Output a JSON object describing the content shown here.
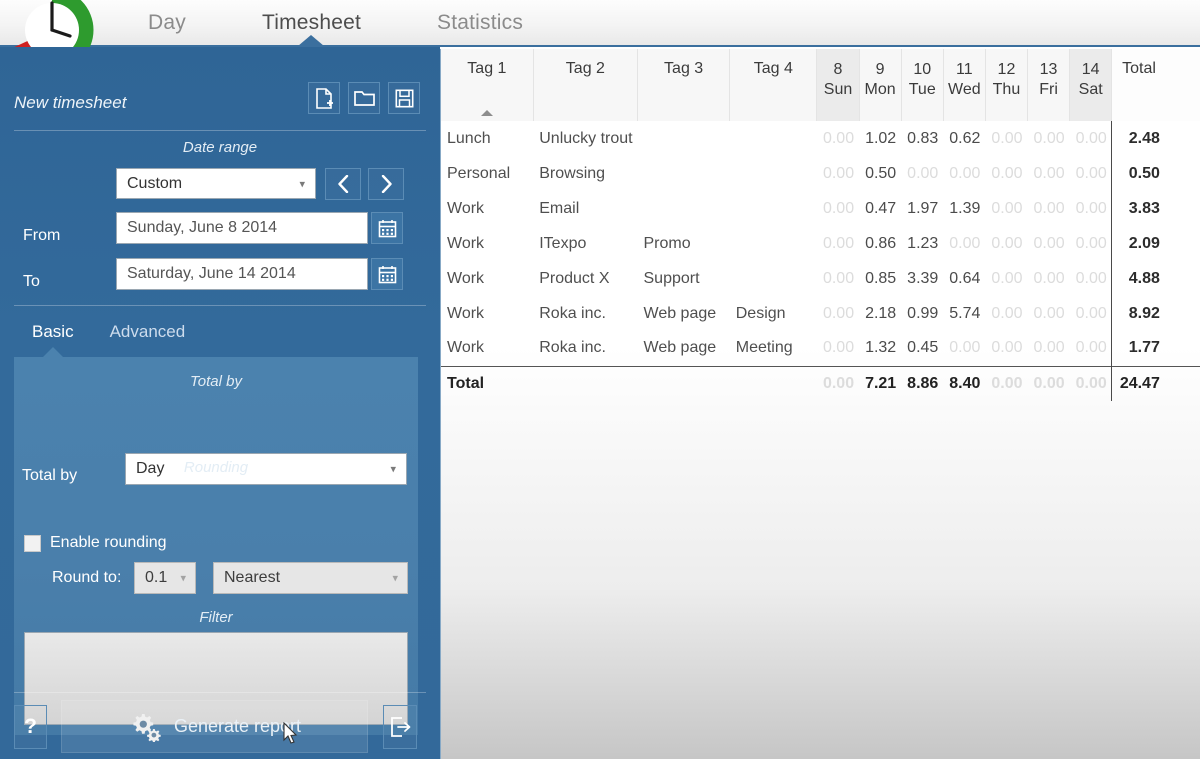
{
  "nav": {
    "tabs": [
      {
        "label": "Day",
        "active": false
      },
      {
        "label": "Timesheet",
        "active": true
      },
      {
        "label": "Statistics",
        "active": false
      }
    ]
  },
  "logo": {
    "name": "clock-logo",
    "green": "#2e9b2e",
    "red": "#cf2020"
  },
  "sidebar": {
    "accent": "#33699a",
    "panel_accent": "#4b82ae",
    "timesheet_title": "New timesheet",
    "icons": {
      "new": "new-document-icon",
      "open": "open-folder-icon",
      "save": "save-floppy-icon"
    },
    "date_range": {
      "section_label": "Date range",
      "preset_value": "Custom",
      "prev_label": "‹",
      "next_label": "›",
      "from_label": "From",
      "from_value": "Sunday, June 8 2014",
      "to_label": "To",
      "to_value": "Saturday, June 14 2014"
    },
    "subtabs": [
      {
        "label": "Basic",
        "active": true
      },
      {
        "label": "Advanced",
        "active": false
      }
    ],
    "total_by": {
      "section_label": "Total by",
      "field_label": "Total by",
      "value": "Day"
    },
    "rounding": {
      "section_label": "Rounding",
      "enable_label": "Enable rounding",
      "enabled": false,
      "round_to_label": "Round to:",
      "amount_value": "0.1",
      "mode_value": "Nearest"
    },
    "filter": {
      "section_label": "Filter",
      "value": "",
      "placeholder": ""
    },
    "footer": {
      "help_label": "?",
      "generate_label": "Generate report",
      "exit_label": "exit-icon"
    }
  },
  "chart_data": {
    "type": "table",
    "title": "Timesheet",
    "columns": [
      "Tag 1",
      "Tag 2",
      "Tag 3",
      "Tag 4",
      "8 Sun",
      "9 Mon",
      "10 Tue",
      "11 Wed",
      "12 Thu",
      "13 Fri",
      "14 Sat",
      "Total"
    ],
    "day_columns": [
      {
        "num": "8",
        "day": "Sun",
        "weekend": true
      },
      {
        "num": "9",
        "day": "Mon",
        "weekend": false
      },
      {
        "num": "10",
        "day": "Tue",
        "weekend": false
      },
      {
        "num": "11",
        "day": "Wed",
        "weekend": false
      },
      {
        "num": "12",
        "day": "Thu",
        "weekend": false
      },
      {
        "num": "13",
        "day": "Fri",
        "weekend": false
      },
      {
        "num": "14",
        "day": "Sat",
        "weekend": true
      }
    ],
    "tag_headers": [
      "Tag 1",
      "Tag 2",
      "Tag 3",
      "Tag 4"
    ],
    "total_header": "Total",
    "sorted_column": "Tag 1",
    "sort_direction": "asc",
    "rows": [
      {
        "tags": [
          "Lunch",
          "Unlucky trout",
          "",
          ""
        ],
        "values": [
          "0.00",
          "1.02",
          "0.83",
          "0.62",
          "0.00",
          "0.00",
          "0.00"
        ],
        "total": "2.48"
      },
      {
        "tags": [
          "Personal",
          "Browsing",
          "",
          ""
        ],
        "values": [
          "0.00",
          "0.50",
          "0.00",
          "0.00",
          "0.00",
          "0.00",
          "0.00"
        ],
        "total": "0.50"
      },
      {
        "tags": [
          "Work",
          "Email",
          "",
          ""
        ],
        "values": [
          "0.00",
          "0.47",
          "1.97",
          "1.39",
          "0.00",
          "0.00",
          "0.00"
        ],
        "total": "3.83"
      },
      {
        "tags": [
          "Work",
          "ITexpo",
          "Promo",
          ""
        ],
        "values": [
          "0.00",
          "0.86",
          "1.23",
          "0.00",
          "0.00",
          "0.00",
          "0.00"
        ],
        "total": "2.09"
      },
      {
        "tags": [
          "Work",
          "Product X",
          "Support",
          ""
        ],
        "values": [
          "0.00",
          "0.85",
          "3.39",
          "0.64",
          "0.00",
          "0.00",
          "0.00"
        ],
        "total": "4.88"
      },
      {
        "tags": [
          "Work",
          "Roka inc.",
          "Web page",
          "Design"
        ],
        "values": [
          "0.00",
          "2.18",
          "0.99",
          "5.74",
          "0.00",
          "0.00",
          "0.00"
        ],
        "total": "8.92"
      },
      {
        "tags": [
          "Work",
          "Roka inc.",
          "Web page",
          "Meeting"
        ],
        "values": [
          "0.00",
          "1.32",
          "0.45",
          "0.00",
          "0.00",
          "0.00",
          "0.00"
        ],
        "total": "1.77"
      }
    ],
    "total_row": {
      "label": "Total",
      "values": [
        "0.00",
        "7.21",
        "8.86",
        "8.40",
        "0.00",
        "0.00",
        "0.00"
      ],
      "total": "24.47"
    }
  }
}
